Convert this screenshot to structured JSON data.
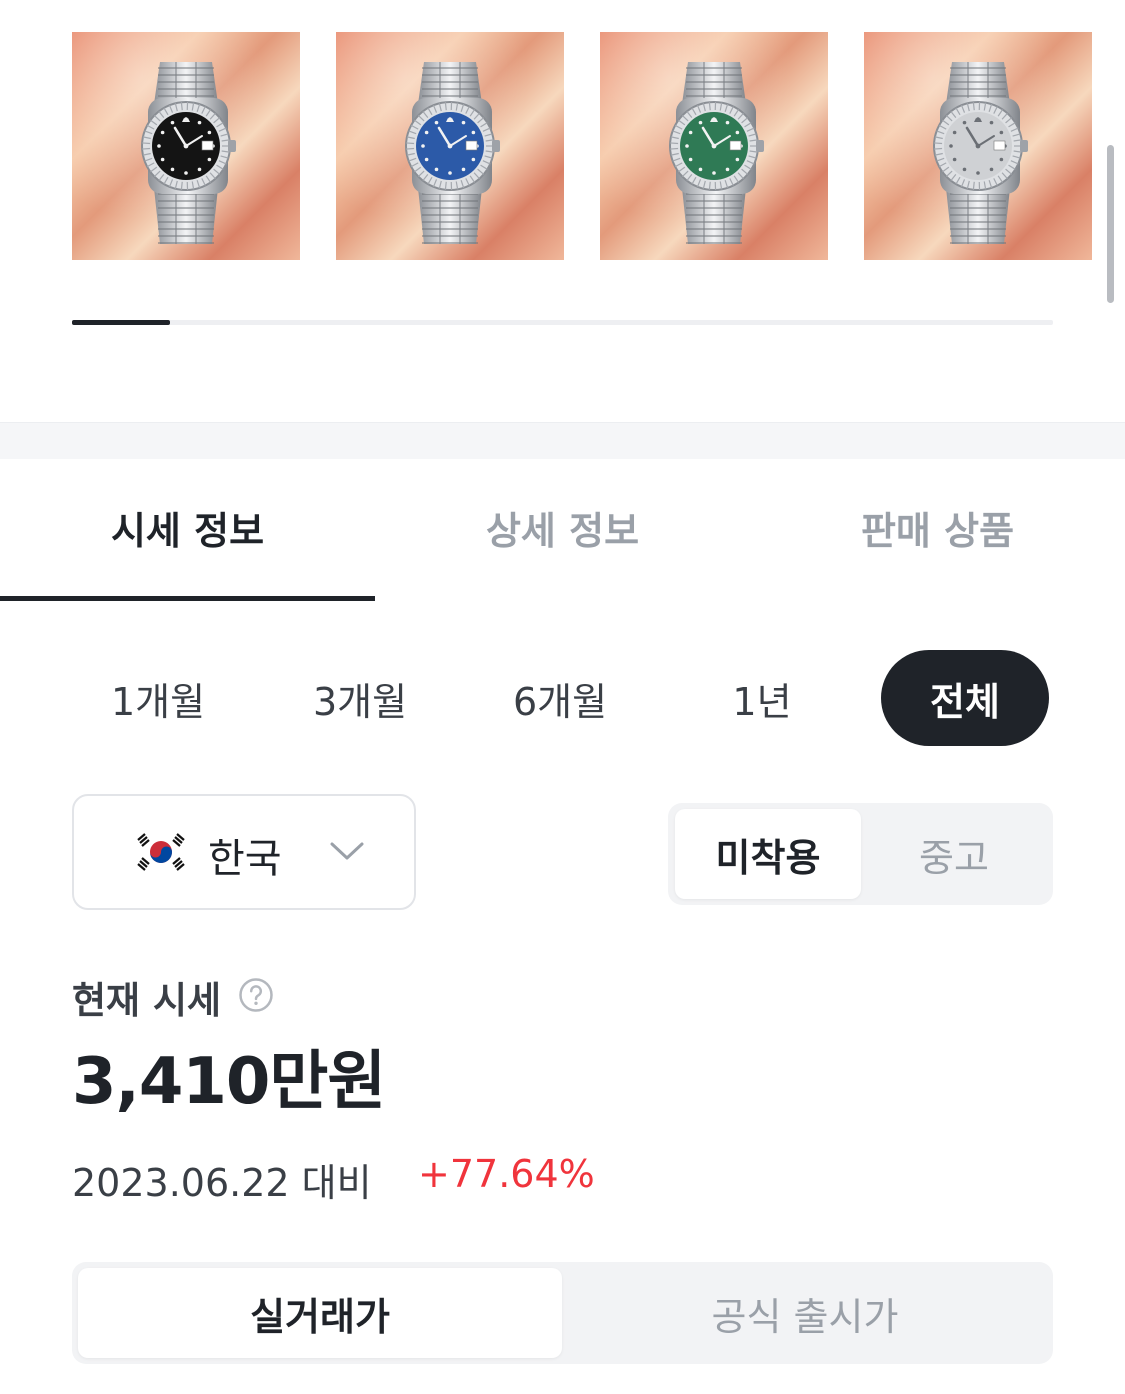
{
  "thumbnails": [
    {
      "dial_color": "#141414",
      "icon": "watch-black-dial"
    },
    {
      "dial_color": "#2c5aa8",
      "icon": "watch-blue-dial"
    },
    {
      "dial_color": "#2f7a55",
      "icon": "watch-green-dial"
    },
    {
      "dial_color": "#cfd1d4",
      "icon": "watch-silver-dial"
    }
  ],
  "tabs": [
    {
      "label": "시세 정보",
      "active": true
    },
    {
      "label": "상세 정보",
      "active": false
    },
    {
      "label": "판매 상품",
      "active": false
    }
  ],
  "periods": [
    {
      "label": "1개월",
      "active": false
    },
    {
      "label": "3개월",
      "active": false
    },
    {
      "label": "6개월",
      "active": false
    },
    {
      "label": "1년",
      "active": false
    },
    {
      "label": "전체",
      "active": true
    }
  ],
  "country": {
    "label": "한국",
    "icon": "korea-flag-icon"
  },
  "condition": [
    {
      "label": "미착용",
      "active": true
    },
    {
      "label": "중고",
      "active": false
    }
  ],
  "price": {
    "label": "현재 시세",
    "value": "3,410만원",
    "compare_text": "2023.06.22 대비",
    "change": "+77.64%",
    "change_color": "#f0343c"
  },
  "price_type": [
    {
      "label": "실거래가",
      "active": true
    },
    {
      "label": "공식 출시가",
      "active": false
    }
  ],
  "colors": {
    "accent": "#1f2329",
    "muted": "#9aa0a8",
    "positive": "#f0343c"
  }
}
